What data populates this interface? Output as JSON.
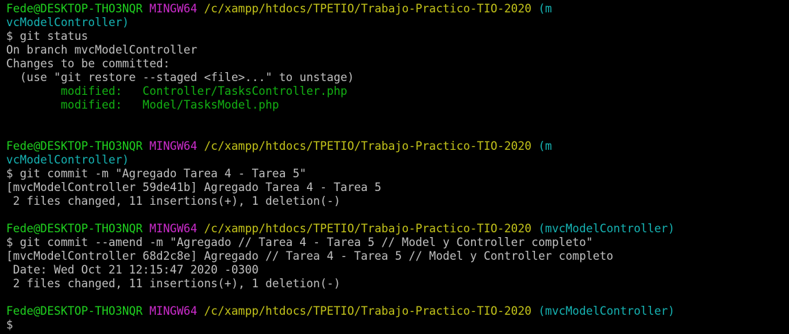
{
  "terminal": {
    "prompt_1": {
      "user": "Fede@DESKTOP-THO3NQR",
      "system": "MINGW64",
      "path": "/c/xampp/htdocs/TPETIO/Trabajo-Practico-TIO-2020",
      "branch_part1": "(m",
      "branch_part2": "vcModelController)"
    },
    "cmd_1": "$ git status",
    "out_1_line1": "On branch mvcModelController",
    "out_1_line2": "Changes to be committed:",
    "out_1_line3": "  (use \"git restore --staged <file>...\" to unstage)",
    "out_1_mod1": "        modified:   Controller/TasksController.php",
    "out_1_mod2": "        modified:   Model/TasksModel.php",
    "prompt_2": {
      "user": "Fede@DESKTOP-THO3NQR",
      "system": "MINGW64",
      "path": "/c/xampp/htdocs/TPETIO/Trabajo-Practico-TIO-2020",
      "branch_part1": "(m",
      "branch_part2": "vcModelController)"
    },
    "cmd_2": "$ git commit -m \"Agregado Tarea 4 - Tarea 5\"",
    "out_2_line1": "[mvcModelController 59de41b] Agregado Tarea 4 - Tarea 5",
    "out_2_line2": " 2 files changed, 11 insertions(+), 1 deletion(-)",
    "prompt_3": {
      "user": "Fede@DESKTOP-THO3NQR",
      "system": "MINGW64",
      "path": "/c/xampp/htdocs/TPETIO/Trabajo-Practico-TIO-2020",
      "branch": "(mvcModelController)"
    },
    "cmd_3": "$ git commit --amend -m \"Agregado // Tarea 4 - Tarea 5 // Model y Controller completo\"",
    "out_3_line1": "[mvcModelController 68d2c8e] Agregado // Tarea 4 - Tarea 5 // Model y Controller completo",
    "out_3_line2": " Date: Wed Oct 21 12:15:47 2020 -0300",
    "out_3_line3": " 2 files changed, 11 insertions(+), 1 deletion(-)",
    "prompt_4": {
      "user": "Fede@DESKTOP-THO3NQR",
      "system": "MINGW64",
      "path": "/c/xampp/htdocs/TPETIO/Trabajo-Practico-TIO-2020",
      "branch": "(mvcModelController)"
    },
    "cmd_4": "$"
  },
  "colors": {
    "background": "#000000",
    "user": "#1fd11f",
    "system": "#cc2ccc",
    "path": "#c4c41a",
    "branch": "#16b3b3",
    "text": "#c0c0c0",
    "modified": "#13b113"
  }
}
